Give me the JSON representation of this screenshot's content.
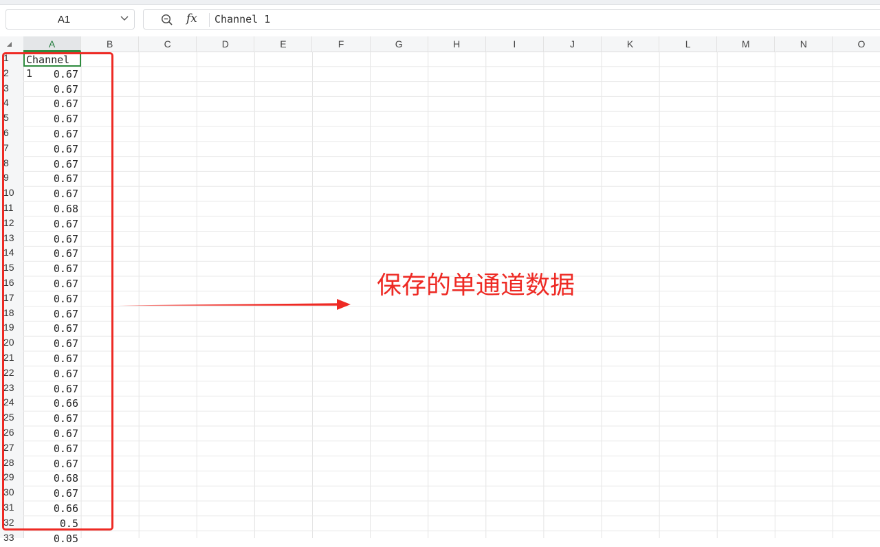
{
  "name_box": {
    "value": "A1"
  },
  "formula_bar": {
    "value": "Channel 1",
    "fx_label": "fx"
  },
  "columns": [
    "A",
    "B",
    "C",
    "D",
    "E",
    "F",
    "G",
    "H",
    "I",
    "J",
    "K",
    "L",
    "M",
    "N",
    "O"
  ],
  "active_column": "A",
  "rows": [
    "1",
    "2",
    "3",
    "4",
    "5",
    "6",
    "7",
    "8",
    "9",
    "10",
    "11",
    "12",
    "13",
    "14",
    "15",
    "16",
    "17",
    "18",
    "19",
    "20",
    "21",
    "22",
    "23",
    "24",
    "25",
    "26",
    "27",
    "28",
    "29",
    "30",
    "31",
    "32",
    "33"
  ],
  "column_a": [
    "Channel 1",
    "0.67",
    "0.67",
    "0.67",
    "0.67",
    "0.67",
    "0.67",
    "0.67",
    "0.67",
    "0.67",
    "0.68",
    "0.67",
    "0.67",
    "0.67",
    "0.67",
    "0.67",
    "0.67",
    "0.67",
    "0.67",
    "0.67",
    "0.67",
    "0.67",
    "0.67",
    "0.66",
    "0.67",
    "0.67",
    "0.67",
    "0.67",
    "0.68",
    "0.67",
    "0.66",
    "0.5",
    "0.05"
  ],
  "annotation": {
    "text": "保存的单通道数据",
    "color": "#ee2a24"
  },
  "colors": {
    "selection": "#2e8b3e",
    "annotation": "#ee2a24"
  }
}
